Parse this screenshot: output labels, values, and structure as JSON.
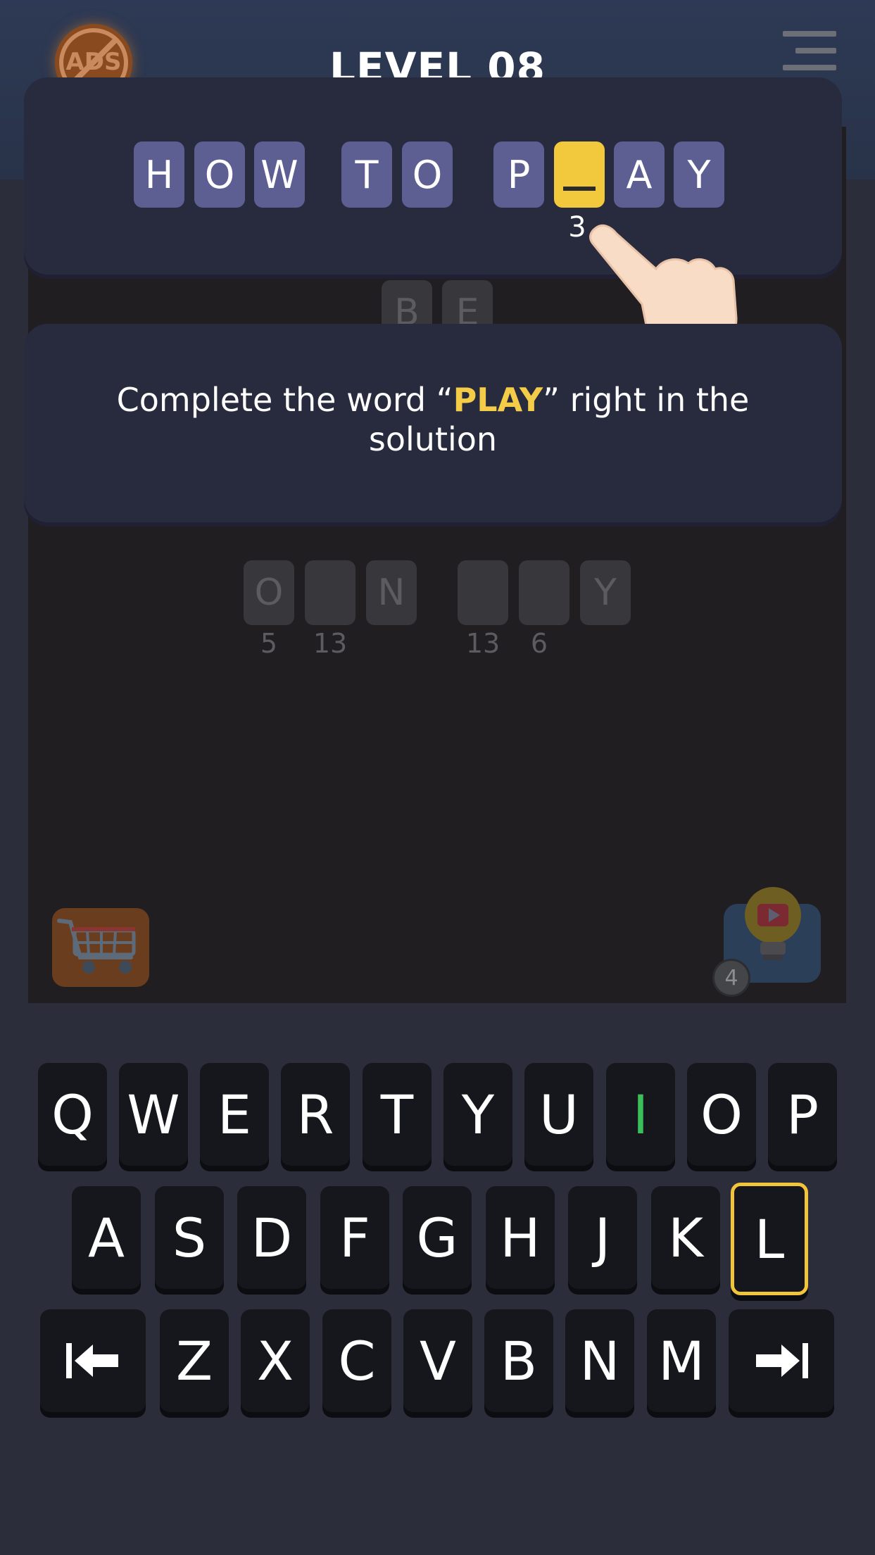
{
  "header": {
    "ads_label": "ADS",
    "level_title": "LEVEL 08"
  },
  "tutorial": {
    "words": [
      [
        "H",
        "O",
        "W"
      ],
      [
        "T",
        "O"
      ],
      [
        "P",
        "",
        "A",
        "Y"
      ]
    ],
    "active_clue_number": "3"
  },
  "instruction": {
    "text_before": "Complete the word “",
    "highlight": "PLAY",
    "text_after": "” right in the solution"
  },
  "board": {
    "partial_word": [
      "B",
      "E"
    ],
    "answer_tiles": [
      "O",
      "",
      "N",
      "",
      "",
      "Y"
    ],
    "answer_numbers": [
      "5",
      "13",
      "",
      "13",
      "6",
      ""
    ]
  },
  "hint": {
    "count": "4"
  },
  "keyboard": {
    "row1": [
      "Q",
      "W",
      "E",
      "R",
      "T",
      "Y",
      "U",
      "I",
      "O",
      "P"
    ],
    "row2": [
      "A",
      "S",
      "D",
      "F",
      "G",
      "H",
      "J",
      "K",
      "L"
    ],
    "row3": [
      "Z",
      "X",
      "C",
      "V",
      "B",
      "N",
      "M"
    ],
    "selected_key": "L",
    "used_key": "I"
  },
  "colors": {
    "tile": "#5d5f93",
    "active_tile": "#f2c83c",
    "highlight_text": "#f4cc48",
    "selected_key_border": "#f2c43a",
    "used_key_letter": "#3bbf5a"
  },
  "icons": [
    "no-ads-icon",
    "menu-icon",
    "shopping-cart-icon",
    "video-hint-icon",
    "pointing-hand-icon",
    "backspace-arrow-icon",
    "forward-arrow-icon"
  ]
}
